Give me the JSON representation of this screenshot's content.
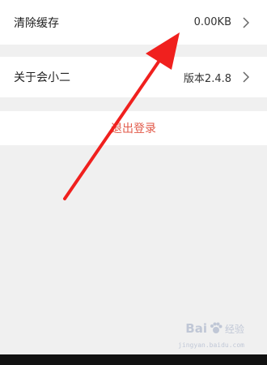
{
  "settings": {
    "clear_cache": {
      "label": "清除缓存",
      "value": "0.00KB"
    },
    "about": {
      "label": "关于会小二",
      "value": "版本2.4.8"
    },
    "logout": {
      "label": "退出登录"
    }
  },
  "watermark": {
    "brand": "Bai",
    "brand_suffix": "经验",
    "url": "jingyan.baidu.com"
  },
  "colors": {
    "background": "#f0f0f0",
    "card": "#ffffff",
    "logout_text": "#e25a4a",
    "arrow": "#f0201e"
  }
}
